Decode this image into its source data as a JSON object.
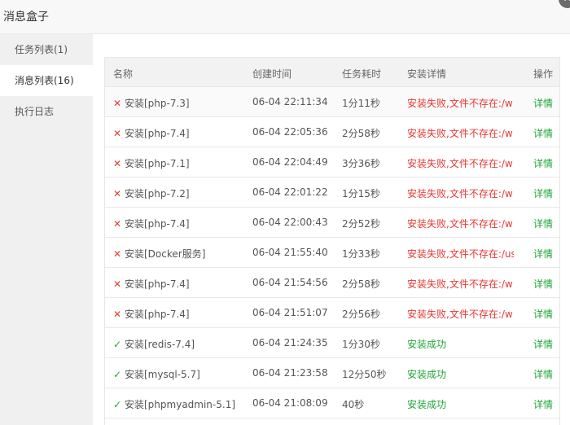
{
  "window": {
    "title": "消息盒子",
    "close_symbol": "✕"
  },
  "sidebar": {
    "items": [
      {
        "label": "任务列表(1)",
        "active": false
      },
      {
        "label": "消息列表(16)",
        "active": true
      },
      {
        "label": "执行日志",
        "active": false
      }
    ]
  },
  "table": {
    "headers": {
      "name": "名称",
      "time": "创建时间",
      "duration": "任务耗时",
      "detail": "安装详情",
      "action": "操作"
    },
    "rows": [
      {
        "status": "fail",
        "name": "安装[php-7.3]",
        "time": "06-04 22:11:34",
        "duration": "1分11秒",
        "detail": "安装失败,文件不存在:/w",
        "action": "详情"
      },
      {
        "status": "fail",
        "name": "安装[php-7.4]",
        "time": "06-04 22:05:36",
        "duration": "2分58秒",
        "detail": "安装失败,文件不存在:/w",
        "action": "详情"
      },
      {
        "status": "fail",
        "name": "安装[php-7.1]",
        "time": "06-04 22:04:49",
        "duration": "3分36秒",
        "detail": "安装失败,文件不存在:/w",
        "action": "详情"
      },
      {
        "status": "fail",
        "name": "安装[php-7.2]",
        "time": "06-04 22:01:22",
        "duration": "1分15秒",
        "detail": "安装失败,文件不存在:/w",
        "action": "详情"
      },
      {
        "status": "fail",
        "name": "安装[php-7.4]",
        "time": "06-04 22:00:43",
        "duration": "2分52秒",
        "detail": "安装失败,文件不存在:/w",
        "action": "详情"
      },
      {
        "status": "fail",
        "name": "安装[Docker服务]",
        "time": "06-04 21:55:40",
        "duration": "1分33秒",
        "detail": "安装失败,文件不存在:/us",
        "action": "详情"
      },
      {
        "status": "fail",
        "name": "安装[php-7.4]",
        "time": "06-04 21:54:56",
        "duration": "2分58秒",
        "detail": "安装失败,文件不存在:/w",
        "action": "详情"
      },
      {
        "status": "fail",
        "name": "安装[php-7.4]",
        "time": "06-04 21:51:07",
        "duration": "2分56秒",
        "detail": "安装失败,文件不存在:/w",
        "action": "详情"
      },
      {
        "status": "ok",
        "name": "安装[redis-7.4]",
        "time": "06-04 21:24:35",
        "duration": "1分30秒",
        "detail": "安装成功",
        "action": "详情"
      },
      {
        "status": "ok",
        "name": "安装[mysql-5.7]",
        "time": "06-04 21:23:58",
        "duration": "12分50秒",
        "detail": "安装成功",
        "action": "详情"
      },
      {
        "status": "ok",
        "name": "安装[phpmyadmin-5.1]",
        "time": "06-04 21:08:09",
        "duration": "40秒",
        "detail": "安装成功",
        "action": "详情"
      }
    ]
  },
  "icons": {
    "fail": "cross-icon",
    "ok": "check-icon"
  },
  "colors": {
    "fail": "#e53935",
    "success": "#20a53a",
    "sidebar_bg": "#f0f0f0",
    "header_bg": "#f2f2f2"
  }
}
